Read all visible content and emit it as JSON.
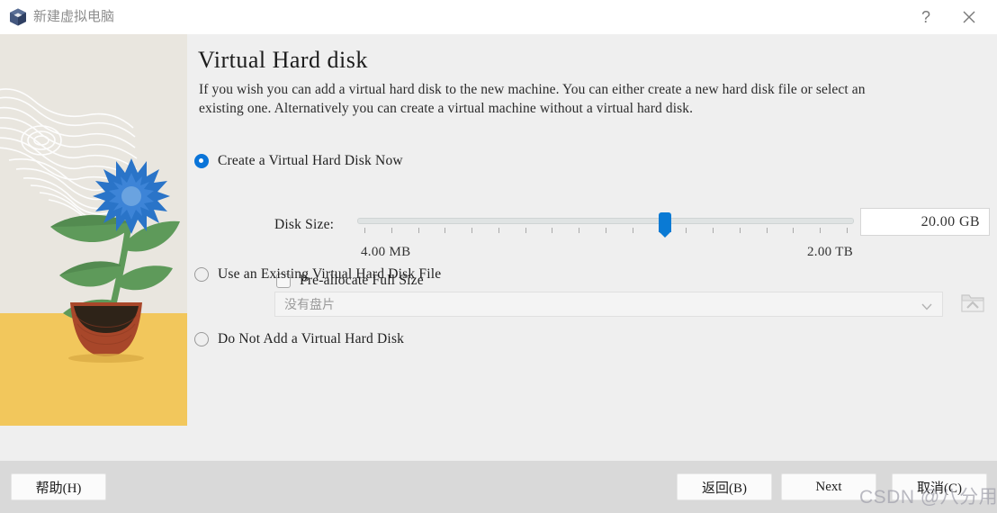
{
  "window": {
    "title": "新建虚拟电脑",
    "icon": "virtualbox-cube-icon",
    "help_glyph": "?",
    "close_glyph": "✕"
  },
  "page": {
    "title": "Virtual Hard disk",
    "description": "If you wish you can add a virtual hard disk to the new machine. You can either create a new hard disk file or select an existing one. Alternatively you can create a virtual machine without a virtual hard disk."
  },
  "options": {
    "create_now": {
      "label": "Create a Virtual Hard Disk Now",
      "selected": true
    },
    "use_existing": {
      "label": "Use an Existing Virtual Hard Disk File",
      "selected": false
    },
    "do_not_add": {
      "label": "Do Not Add a Virtual Hard Disk",
      "selected": false
    }
  },
  "disk_size": {
    "label": "Disk Size:",
    "value": "20.00 GB",
    "min_label": "4.00 MB",
    "max_label": "2.00 TB",
    "slider_percent": 62,
    "tick_count": 19
  },
  "preallocate": {
    "label": "Pre-allocate Full Size",
    "checked": false
  },
  "existing_disk": {
    "combo_value": "没有盘片",
    "arrow_glyph": "⌄",
    "browse_icon": "folder-open-icon"
  },
  "footer": {
    "help": "帮助(H)",
    "back": "返回(B)",
    "next": "Next",
    "cancel": "取消(C)"
  },
  "watermark": "CSDN @八分用心",
  "colors": {
    "accent": "#0a74d8",
    "titlebar_bg": "#ffffff",
    "content_bg": "#efefef",
    "footer_bg": "#d9d9d9",
    "illustration_bg": "#e9e6df",
    "illustration_ground": "#f2c75c",
    "flower": "#2a74c8",
    "leaf": "#5e9a5a",
    "pot": "#a8472a"
  }
}
